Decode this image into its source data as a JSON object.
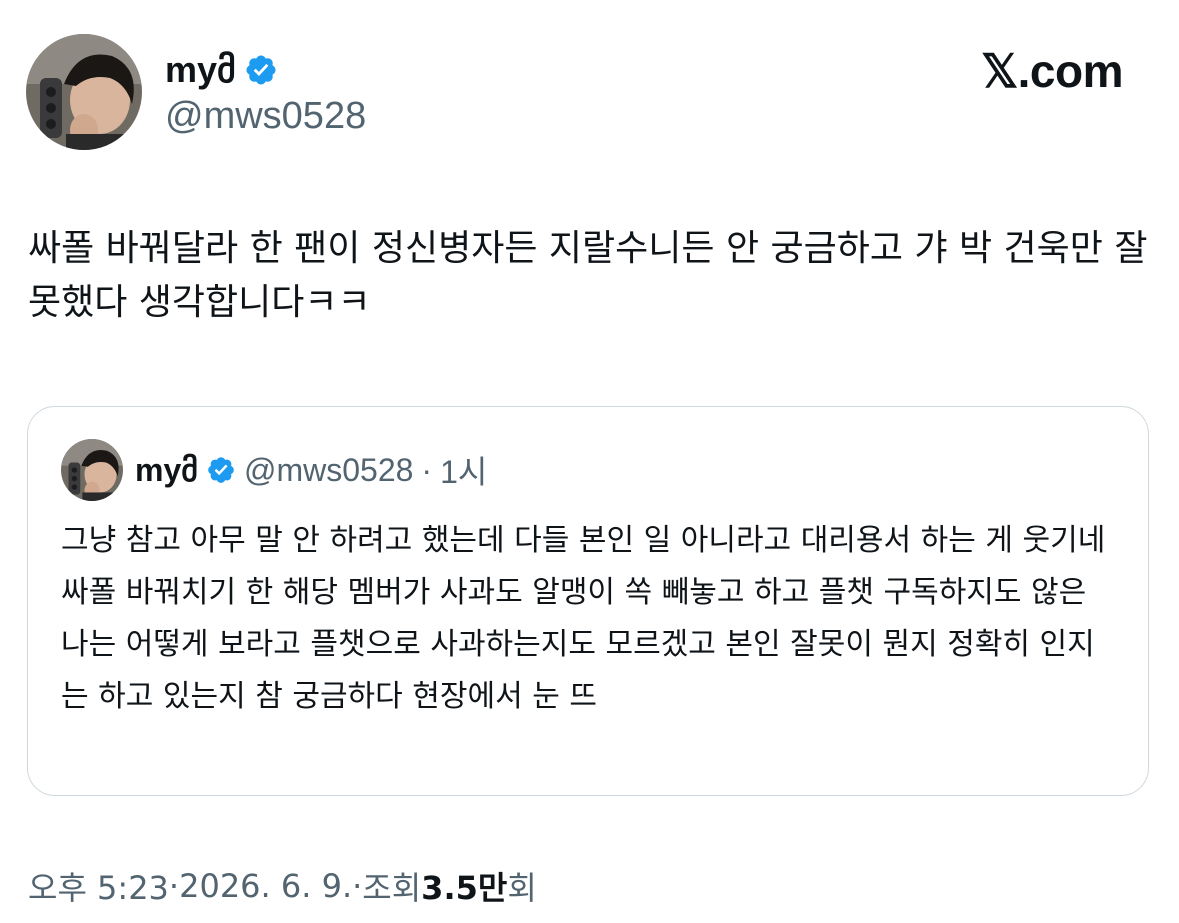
{
  "author": {
    "display_name": "myმ",
    "handle": "@mws0528",
    "verified_icon": "verified-badge-icon",
    "avatar": "avatar-photo"
  },
  "brand": {
    "label": "𝕏.com",
    "icon": "x-logo-icon"
  },
  "tweet": {
    "text": "싸폴 바꿔달라 한 팬이 정신병자든 지랄수니든 안 궁금하고 갸 박 건욱만 잘못했다 생각합니다ㅋㅋ"
  },
  "quoted_tweet": {
    "display_name": "myმ",
    "handle": "@mws0528",
    "separator": "·",
    "time": "1시",
    "text": "그냥 참고 아무 말 안 하려고 했는데 다들 본인 일 아니라고 대리용서 하는 게 웃기네 싸폴 바꿔치기 한 해당 멤버가 사과도 알맹이 쏙 빼놓고 하고 플챗 구독하지도 않은 나는 어떻게 보라고 플챗으로 사과하는지도 모르겠고 본인 잘못이 뭔지 정확히 인지는 하고 있는지 참 궁금하다 현장에서 눈 뜨"
  },
  "meta": {
    "time": "오후 5:23",
    "sep1": " · ",
    "date": "2026. 6. 9.",
    "sep2": " · ",
    "views_label": "조회 ",
    "views_count": "3.5만",
    "views_suffix": "회"
  },
  "colors": {
    "text_primary": "#0f1419",
    "text_secondary": "#536471",
    "verified_blue": "#1d9bf0",
    "card_border": "#cfd9de"
  }
}
